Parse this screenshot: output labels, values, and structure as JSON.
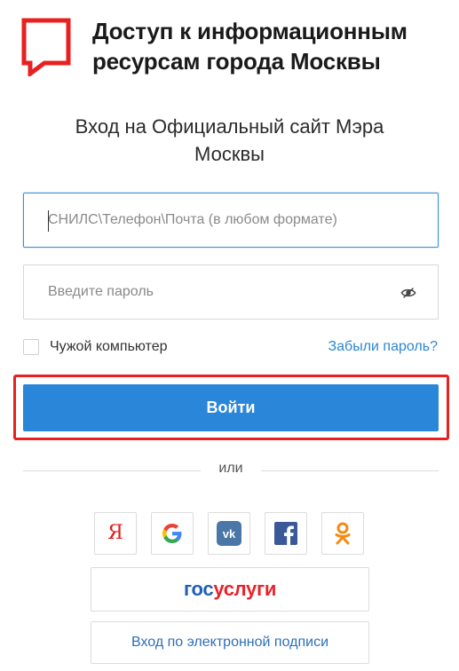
{
  "header": {
    "logo_icon": "speech-bubble-icon",
    "logo_color": "#e82020",
    "title_line1": "Доступ к информационным",
    "title_line2": "ресурсам города Москвы"
  },
  "subtitle_line1": "Вход на Официальный сайт Мэра",
  "subtitle_line2": "Москвы",
  "form": {
    "login_placeholder": "СНИЛС\\Телефон\\Почта (в любом формате)",
    "login_value": "",
    "password_placeholder": "Введите пароль",
    "password_value": "",
    "password_toggle_icon": "eye-hidden-icon",
    "remember_label": "Чужой компьютер",
    "remember_checked": false,
    "forgot_link": "Забыли пароль?",
    "submit_label": "Войти",
    "accent_color": "#2a86d8",
    "highlight_color": "#e82020"
  },
  "divider_text": "или",
  "socials": [
    {
      "name": "yandex",
      "icon": "yandex-icon",
      "text": "Я"
    },
    {
      "name": "google",
      "icon": "google-icon"
    },
    {
      "name": "vk",
      "icon": "vk-icon"
    },
    {
      "name": "facebook",
      "icon": "facebook-icon"
    },
    {
      "name": "odnoklassniki",
      "icon": "odnoklassniki-icon"
    }
  ],
  "gosuslugi": {
    "part1": "гос",
    "part2": "услуги",
    "color1": "#1f5fb4",
    "color2": "#e8242b"
  },
  "signature_label": "Вход по электронной подписи"
}
